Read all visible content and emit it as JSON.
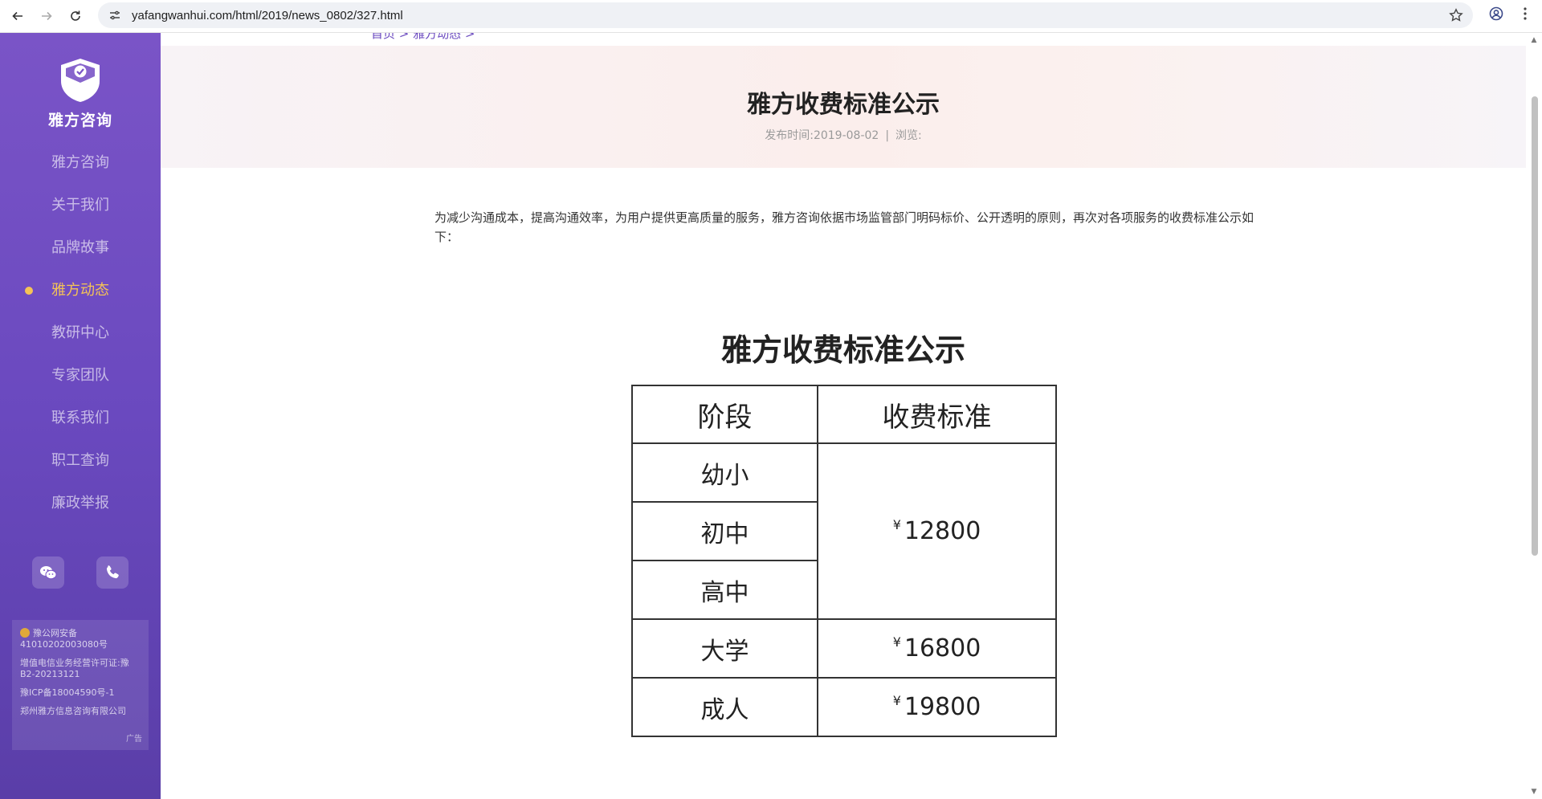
{
  "browser": {
    "url": "yafangwanhui.com/html/2019/news_0802/327.html"
  },
  "sidebar": {
    "logo_text": "雅方咨询",
    "items": [
      {
        "label": "雅方咨询",
        "active": false
      },
      {
        "label": "关于我们",
        "active": false
      },
      {
        "label": "品牌故事",
        "active": false
      },
      {
        "label": "雅方动态",
        "active": true
      },
      {
        "label": "教研中心",
        "active": false
      },
      {
        "label": "专家团队",
        "active": false
      },
      {
        "label": "联系我们",
        "active": false
      },
      {
        "label": "职工查询",
        "active": false
      },
      {
        "label": "廉政举报",
        "active": false
      }
    ],
    "social": [
      "wechat-icon",
      "phone-icon"
    ],
    "footer": {
      "police_record": "豫公网安备41010202003080号",
      "telecom_license": "增值电信业务经营许可证:豫B2-20213121",
      "icp": "豫ICP备18004590号-1",
      "company": "郑州雅方信息咨询有限公司",
      "ad": "广告"
    }
  },
  "breadcrumb": "首页 > 雅方动态 >",
  "article": {
    "title": "雅方收费标准公示",
    "publish_label": "发布时间:",
    "publish_date": "2019-08-02",
    "separator": "|",
    "views_label": "浏览:",
    "intro": "为减少沟通成本，提高沟通效率，为用户提供更高质量的服务，雅方咨询依据市场监管部门明码标价、公开透明的原则，再次对各项服务的收费标准公示如下："
  },
  "fee_table": {
    "title": "雅方收费标准公示",
    "headers": [
      "阶段",
      "收费标准"
    ],
    "currency": "¥",
    "rows": [
      {
        "stage": "幼小",
        "fee": "12800",
        "group": "k12"
      },
      {
        "stage": "初中",
        "fee": "12800",
        "group": "k12"
      },
      {
        "stage": "高中",
        "fee": "12800",
        "group": "k12"
      },
      {
        "stage": "大学",
        "fee": "16800"
      },
      {
        "stage": "成人",
        "fee": "19800"
      }
    ]
  }
}
